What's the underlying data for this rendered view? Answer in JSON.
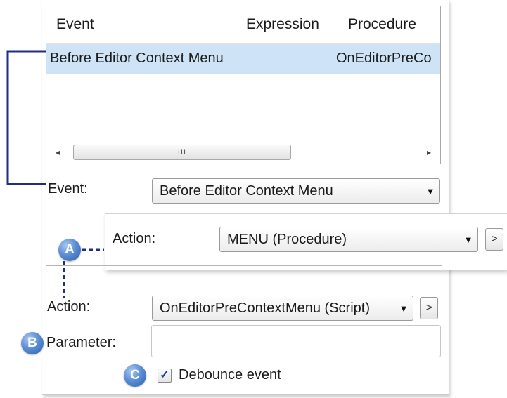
{
  "grid": {
    "columns": [
      "Event",
      "Expression",
      "Procedure"
    ],
    "rows": [
      {
        "event": "Before Editor Context Menu",
        "expression": "",
        "procedure": "OnEditorPreCo"
      }
    ],
    "scrollbar": {
      "left_arrow": "◂",
      "right_arrow": "▸",
      "grip": "III"
    }
  },
  "event_field": {
    "label": "Event:",
    "value": "Before Editor Context Menu"
  },
  "callout_action": {
    "label": "Action:",
    "value": "MENU (Procedure)"
  },
  "action_field": {
    "label": "Action:",
    "value": "OnEditorPreContextMenu (Script)"
  },
  "parameter_field": {
    "label": "Parameter:",
    "value": ""
  },
  "debounce": {
    "label": "Debounce event",
    "checked": true,
    "mark": "✓"
  },
  "combo_arrow": "▼",
  "go_button": ">",
  "badges": {
    "a": "A",
    "b": "B",
    "c": "C"
  },
  "colors": {
    "leader_line": "#1f2f80",
    "badge": "#4a7fcc",
    "selected_row": "#cfe3f6"
  }
}
